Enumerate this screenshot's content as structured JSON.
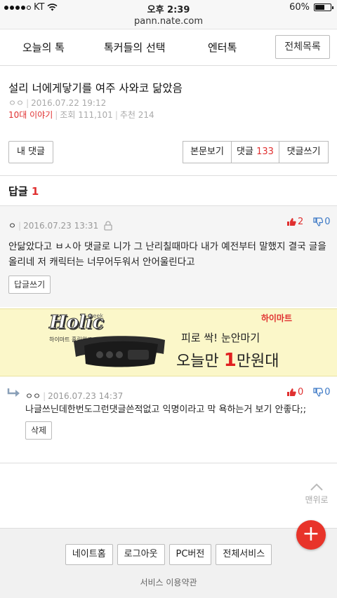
{
  "status_bar": {
    "carrier": "KT",
    "time": "오후 2:39",
    "battery": "60%",
    "battery_level": 0.6
  },
  "url_bar": {
    "url": "pann.nate.com"
  },
  "nav": {
    "tabs": [
      "오늘의 톡",
      "톡커들의 선택",
      "엔터톡"
    ],
    "all_list_label": "전체목록"
  },
  "post": {
    "title": "설리 너에게닿기를 여주 사와코 닮았음",
    "author": "ㅇㅇ",
    "date": "2016.07.22 19:12",
    "category": "10대 이야기",
    "views": "조회 111,101",
    "recommends": "추천 214"
  },
  "actions": {
    "my_comments": "내 댓글",
    "view_post": "본문보기",
    "comments_label": "댓글",
    "comments_count": "133",
    "write_comment": "댓글쓰기"
  },
  "replies_header": {
    "label": "답글",
    "count": "1"
  },
  "comment": {
    "author": "ㅇ",
    "date": "2016.07.23 13:31",
    "up": "2",
    "down": "0",
    "text": "안닮았다고 ㅂㅅ아 댓글로 니가 그 난리칠때마다 내가 예전부터 말했지 결국 글을 올리네 저 캐릭터는 너무어두워서 안어울린다고",
    "reply_button": "답글쓰기"
  },
  "ad": {
    "holic": "Holic",
    "week": "week",
    "holic_sub": "하이마트 홀릭위크 7.18 ~ 7.24",
    "brand": "하이마트",
    "line1": "피로 싹! 눈안마기",
    "line2_prefix": "오늘만 ",
    "line2_num": "1",
    "line2_suffix": "만원대"
  },
  "reply": {
    "author": "ㅇㅇ",
    "date": "2016.07.23 14:37",
    "up": "0",
    "down": "0",
    "text": "나글쓰닌데한번도그런댓글쓴적없고 익명이라고 막 욕하는거 보기 안좋다;;",
    "delete_button": "삭제"
  },
  "top_button": {
    "label": "맨위로"
  },
  "footer": {
    "links": [
      "네이트홈",
      "로그아웃",
      "PC버전",
      "전체서비스"
    ],
    "terms": "서비스 이용약관"
  },
  "colors": {
    "accent_red": "#e03030",
    "down_blue": "#3a77c5",
    "fab_red": "#e8342a"
  }
}
